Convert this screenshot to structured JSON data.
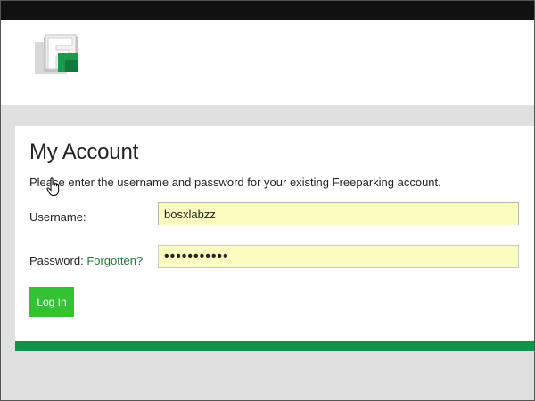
{
  "colors": {
    "topbar": "#111111",
    "accent_green": "#0f9447",
    "button_green": "#33c233",
    "input_bg": "#fafcc0",
    "page_bg": "#e0e0e0"
  },
  "header": {
    "logo_icon": "freeparking-logo-icon"
  },
  "account": {
    "title": "My Account",
    "intro": "Please enter the username and password for your existing Freeparking account.",
    "username_label": "Username:",
    "username_value": "bosxlabzz",
    "password_label": "Password:",
    "forgotten_link": "Forgotten?",
    "password_value": "•••••••••••",
    "login_label": "Log In"
  },
  "cursor_icon": "hand-pointer-icon"
}
